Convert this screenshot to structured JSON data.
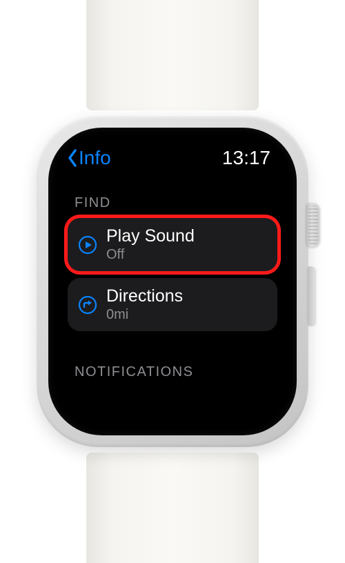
{
  "colors": {
    "accent": "#0a84ff",
    "highlight": "#ff1a1a"
  },
  "status": {
    "back_label": "Info",
    "time": "13:17"
  },
  "sections": {
    "find": {
      "header": "FIND",
      "play_sound": {
        "title": "Play Sound",
        "sub": "Off",
        "icon": "play-circle-icon"
      },
      "directions": {
        "title": "Directions",
        "sub": "0mi",
        "icon": "directions-circle-icon"
      }
    },
    "notifications": {
      "header": "NOTIFICATIONS"
    }
  }
}
